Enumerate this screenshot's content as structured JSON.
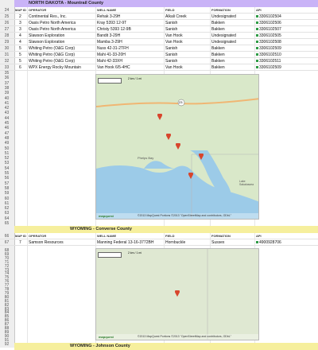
{
  "colors": {
    "nd_header": "#c9b3f7",
    "wy_header": "#f6ef9d",
    "pin": "#d8452c",
    "water": "#9ccbe8",
    "land": "#d7e7c8"
  },
  "nd": {
    "title": "NORTH DAKOTA - Mountrail County",
    "rows": [
      {
        "rn": "25",
        "map": "2",
        "op": "Continental Res., Inc.",
        "well": "Rehak 3-29H",
        "field": "Alkali Creek",
        "form": "Undesignated",
        "api": "3306102504"
      },
      {
        "rn": "26",
        "map": "3",
        "op": "Oasis Petro North America",
        "well": "Kray 5393 12-9T",
        "field": "Sanish",
        "form": "Bakken",
        "api": "3306102506"
      },
      {
        "rn": "27",
        "map": "3",
        "op": "Oasis Petro North America",
        "well": "Christy 5393 12-9B",
        "field": "Sanish",
        "form": "Bakken",
        "api": "3306102507"
      },
      {
        "rn": "28",
        "map": "4",
        "op": "Slawson Exploration",
        "well": "Bandit 3-29H",
        "field": "Van Hook",
        "form": "Undesignated",
        "api": "3306102505"
      },
      {
        "rn": "29",
        "map": "4",
        "op": "Slawson Exploration",
        "well": "Mamba 3-29H",
        "field": "Van Hook",
        "form": "Undesignated",
        "api": "3306102508"
      },
      {
        "rn": "30",
        "map": "5",
        "op": "Whiting Petro (O&G Corp)",
        "well": "Nuss 42-31-2TFH",
        "field": "Sanish",
        "form": "Bakken",
        "api": "3306102509"
      },
      {
        "rn": "31",
        "map": "5",
        "op": "Whiting Petro (O&G Corp)",
        "well": "Mahi 41-33-20H",
        "field": "Sanish",
        "form": "Bakken",
        "api": "3306102510"
      },
      {
        "rn": "32",
        "map": "5",
        "op": "Whiting Petro (O&G Corp)",
        "well": "Mahi 42-33XH",
        "field": "Sanish",
        "form": "Bakken",
        "api": "3306102511"
      },
      {
        "rn": "33",
        "map": "6",
        "op": "WPX Energy Rocky Mountain",
        "well": "Van Hook 6/5-4HC",
        "field": "Van Hook",
        "form": "Bakken",
        "api": "3306102509"
      }
    ]
  },
  "header_cols": {
    "map": "MAP ID",
    "op": "OPERATOR",
    "well": "WELL NAME",
    "field": "FIELD",
    "form": "FORMATION",
    "api": "API"
  },
  "wy": {
    "title": "WYOMING - Converse County",
    "rows": [
      {
        "rn": "67",
        "map": "7",
        "op": "Samson Resources",
        "well": "Manning Federal 13-16-3772BH",
        "field": "Hornbuckle",
        "form": "Sussex",
        "api": "4900928706"
      }
    ]
  },
  "next_section": "WYOMING - Johnson County",
  "map1": {
    "scale": "2 km / 1 mi",
    "lake_label": "Lake Sakakawea",
    "bay_label": "Phelps Bay",
    "road_label": "23",
    "pins": [
      "2",
      "3",
      "4",
      "5",
      "6"
    ],
    "attribution": "©2013 MapQuest  Portions ©2013 \"OpenStreetMap and contributors, ODbL\""
  },
  "map2": {
    "scale": "2 km / 1 mi",
    "pins": [
      "7"
    ],
    "attribution": "©2013 MapQuest  Portions ©2013 \"OpenStreetMap and contributors, ODbL\""
  },
  "logo": "mapquest",
  "row_numbers": [
    "35",
    "36",
    "37",
    "38",
    "39",
    "40",
    "41",
    "42",
    "43",
    "44",
    "45",
    "46",
    "47",
    "48",
    "49",
    "50",
    "51",
    "52",
    "53",
    "54",
    "55",
    "56",
    "57",
    "58",
    "59",
    "60",
    "61",
    "62",
    "63",
    "64",
    "65",
    "68",
    "69",
    "70",
    "71",
    "72",
    "73",
    "74",
    "75",
    "76",
    "77",
    "78",
    "79",
    "80",
    "81",
    "82",
    "83",
    "84",
    "85",
    "86",
    "87",
    "88",
    "89",
    "90",
    "91",
    "92"
  ]
}
